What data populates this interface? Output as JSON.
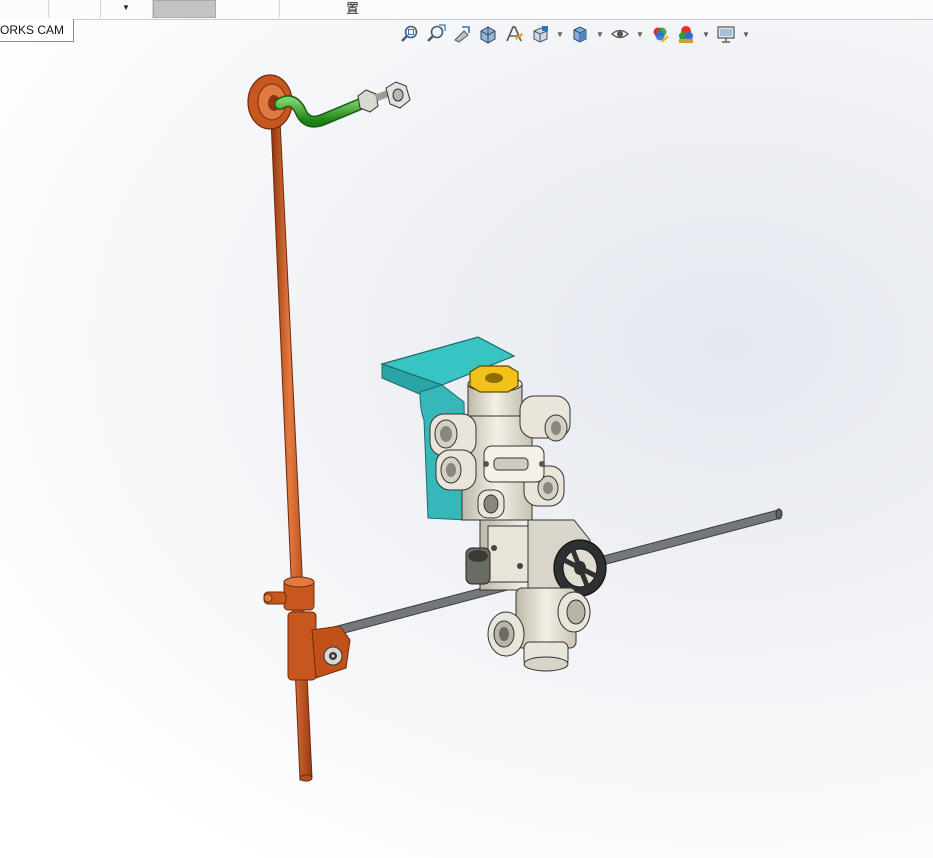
{
  "tabs": {
    "cam_label": "ORKS CAM",
    "top_glyph": "置"
  },
  "view_toolbar": {
    "icons": [
      "zoom-to-fit-icon",
      "zoom-to-area-icon",
      "previous-view-icon",
      "section-view-icon",
      "dynamic-annotation-icon",
      "view-orientation-icon",
      "display-style-icon",
      "hide-show-items-icon",
      "edit-appearance-icon",
      "apply-scene-icon",
      "view-settings-icon"
    ]
  },
  "colors": {
    "pipe_copper": "#c8561f",
    "pipe_green": "#2fa21f",
    "bracket_teal": "#39c4c4",
    "valve_body": "#e6e2d6",
    "nut_yellow": "#f2c21a",
    "rod_grey": "#6e7176",
    "bg_gradient_center": "#e4e8ef"
  }
}
